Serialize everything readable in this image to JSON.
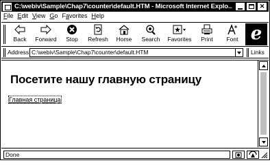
{
  "window": {
    "title": "C:\\webiv\\Sample\\Chap7\\counter\\default.HTM - Microsoft Internet Explo..."
  },
  "menu": [
    {
      "label": "File",
      "accel": "F",
      "rest": "ile"
    },
    {
      "label": "Edit",
      "accel": "E",
      "rest": "dit"
    },
    {
      "label": "View",
      "accel": "V",
      "rest": "iew"
    },
    {
      "label": "Go",
      "accel": "G",
      "rest": "o"
    },
    {
      "label": "Favorites",
      "accel": "a",
      "rest_before": "F",
      "rest": "vorites"
    },
    {
      "label": "Help",
      "accel": "H",
      "rest": "elp"
    }
  ],
  "toolbar": {
    "back": "Back",
    "forward": "Forward",
    "stop": "Stop",
    "refresh": "Refresh",
    "home": "Home",
    "search": "Search",
    "favorites": "Favorites",
    "print": "Print",
    "font": "Font"
  },
  "address": {
    "label": "Address",
    "value": "C:\\webiv\\Sample\\Chap7\\counter\\default.HTM",
    "links_label": "Links"
  },
  "page": {
    "heading": "Посетите нашу главную страницу",
    "link": "Главная страница"
  },
  "status": {
    "text": "Done"
  }
}
